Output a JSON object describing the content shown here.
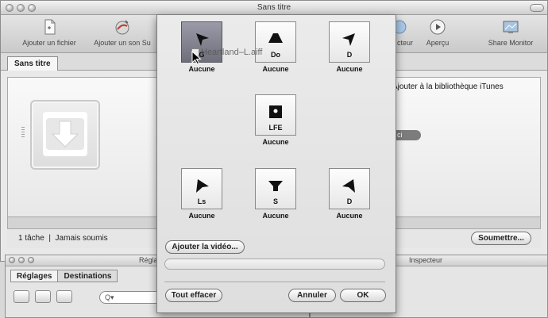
{
  "window": {
    "title": "Sans titre"
  },
  "toolbar": {
    "items": [
      {
        "label": "Ajouter un fichier",
        "icon": "document-add-icon"
      },
      {
        "label": "Ajouter un son Su",
        "icon": "audio-add-icon"
      },
      {
        "label": "cteur",
        "icon": "viewer-icon"
      },
      {
        "label": "Aperçu",
        "icon": "play-icon"
      },
      {
        "label": "Share Monitor",
        "icon": "monitor-icon"
      }
    ]
  },
  "tabs": {
    "main": "Sans titre"
  },
  "batch": {
    "itunes_label": "Ajouter à la bibliothèque iTunes",
    "pill_text": "ci"
  },
  "status": {
    "tasks": "1 tâche",
    "separator": "|",
    "submitted": "Jamais soumis",
    "submit_button": "Soumettre..."
  },
  "lower": {
    "left_title": "Régla",
    "right_title": "Inspecteur",
    "tabs": [
      "Réglages",
      "Destinations"
    ],
    "search_placeholder": "Q▾"
  },
  "sheet": {
    "file_name": "Heartland–L.aiff",
    "channels": [
      {
        "id": "l",
        "letters": "G",
        "status": "Aucune",
        "selected": true
      },
      {
        "id": "c",
        "letters": "Do",
        "status": "Aucune",
        "selected": false
      },
      {
        "id": "r",
        "letters": "D",
        "status": "Aucune",
        "selected": false
      },
      {
        "id": "lfe",
        "letters": "LFE",
        "status": "Aucune",
        "selected": false
      },
      {
        "id": "ls",
        "letters": "Ls",
        "status": "Aucune",
        "selected": false
      },
      {
        "id": "s",
        "letters": "S",
        "status": "Aucune",
        "selected": false
      },
      {
        "id": "rs",
        "letters": "D",
        "status": "Aucune",
        "selected": false
      }
    ],
    "add_video_button": "Ajouter la vidéo...",
    "clear_button": "Tout effacer",
    "cancel_button": "Annuler",
    "ok_button": "OK"
  }
}
